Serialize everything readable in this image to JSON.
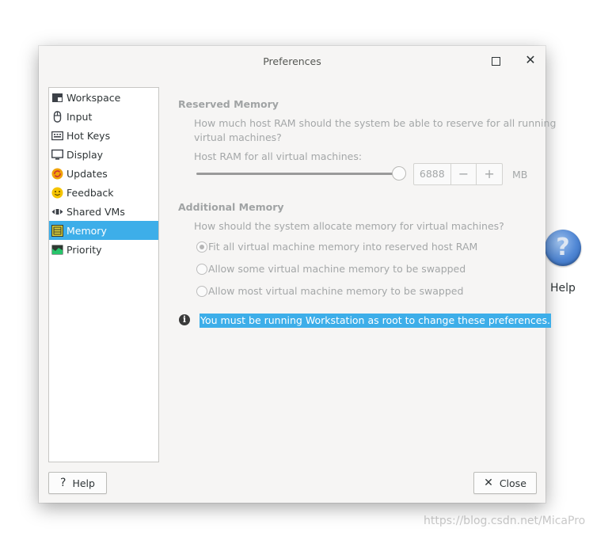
{
  "dialog": {
    "title": "Preferences"
  },
  "sidebar": {
    "items": [
      {
        "label": "Workspace",
        "icon": "workspace-icon"
      },
      {
        "label": "Input",
        "icon": "mouse-icon"
      },
      {
        "label": "Hot Keys",
        "icon": "keyboard-icon"
      },
      {
        "label": "Display",
        "icon": "monitor-icon"
      },
      {
        "label": "Updates",
        "icon": "updates-icon"
      },
      {
        "label": "Feedback",
        "icon": "smiley-icon"
      },
      {
        "label": "Shared VMs",
        "icon": "shared-vms-icon"
      },
      {
        "label": "Memory",
        "icon": "memory-chip-icon",
        "selected": true
      },
      {
        "label": "Priority",
        "icon": "priority-icon"
      }
    ]
  },
  "reserved": {
    "title": "Reserved Memory",
    "question": "How much host RAM should the system be able to reserve for all running",
    "question_cont": "virtual machines?",
    "host_ram_label": "Host RAM for all virtual machines:",
    "value": "6888",
    "minus": "−",
    "plus": "+",
    "unit": "MB",
    "slider_fraction": 1.0
  },
  "additional": {
    "title": "Additional Memory",
    "question": "How should the system allocate memory for virtual machines?",
    "options": [
      {
        "label": "Fit all virtual machine memory into reserved host RAM",
        "selected": true
      },
      {
        "label": "Allow some virtual machine memory to be swapped",
        "selected": false
      },
      {
        "label": "Allow most virtual machine memory to be swapped",
        "selected": false
      }
    ]
  },
  "notice": {
    "icon": "i",
    "text": "You must be running Workstation as root to change these preferences."
  },
  "buttons": {
    "help_icon": "?",
    "help": "Help",
    "close_icon": "✕",
    "close": "Close"
  },
  "desktop": {
    "help_icon_glyph": "?",
    "help_label": "Help"
  },
  "watermark": "https://blog.csdn.net/MicaPro",
  "colors": {
    "accent": "#3daee9",
    "dialog_bg": "#f6f5f4"
  }
}
